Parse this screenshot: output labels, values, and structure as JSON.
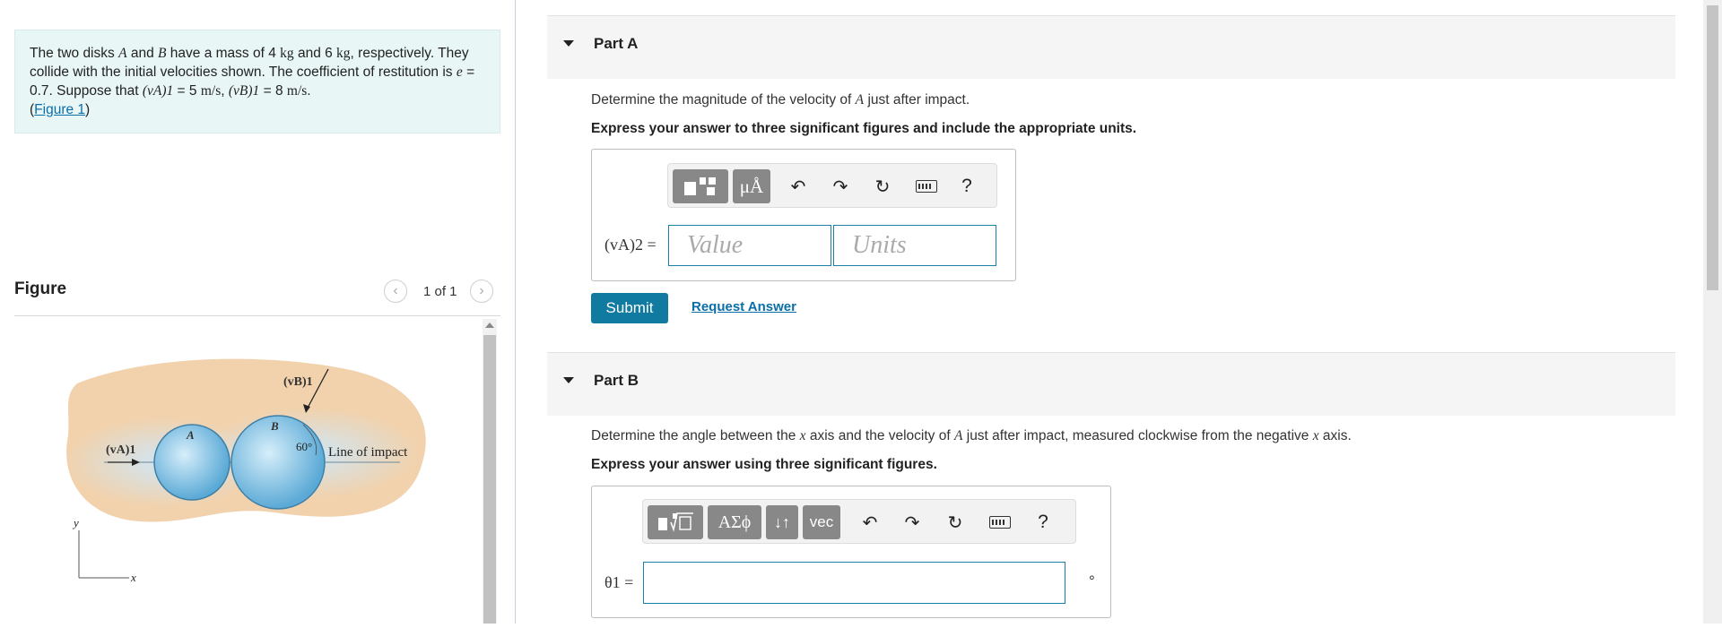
{
  "problem": {
    "t1": "The two disks ",
    "diskA": "A",
    "t2": " and ",
    "diskB": "B",
    "t3": " have a mass of 4 ",
    "unit_kg1": "kg",
    "t4": " and 6 ",
    "unit_kg2": "kg",
    "t5": ", respectively. They collide with the initial velocities shown. The coefficient of restitution is ",
    "e_sym": "e",
    "t6": " = 0.7. Suppose that ",
    "vA1": "(vA)1",
    "t7": " = 5 ",
    "unit_ms1": "m/s",
    "t8": ", ",
    "vB1": "(vB)1",
    "t9": " = 8 ",
    "unit_ms2": "m/s",
    "t10": ".",
    "figure_link": "Figure 1"
  },
  "figure_panel": {
    "title": "Figure",
    "count": "1 of 1",
    "labels": {
      "vb1": "(vB)1",
      "va1": "(vA)1",
      "disk_a": "A",
      "disk_b": "B",
      "angle": "60°",
      "line_of_impact": "Line of impact",
      "axis_y": "y",
      "axis_x": "x"
    }
  },
  "part_a": {
    "title": "Part A",
    "question_pre": "Determine the magnitude of the velocity of ",
    "question_sym": "A",
    "question_post": " just after impact.",
    "instruction": "Express your answer to three significant figures and include the appropriate units.",
    "toolbar": {
      "units_btn": "μÅ",
      "help": "?"
    },
    "answer_label": "(vA)2 =",
    "value_placeholder": "Value",
    "units_placeholder": "Units",
    "submit": "Submit",
    "request": "Request Answer"
  },
  "part_b": {
    "title": "Part B",
    "question_pre": "Determine the angle between the ",
    "x1": "x",
    "question_mid": " axis and the velocity of ",
    "A": "A",
    "question_mid2": " just after impact, measured clockwise from the negative ",
    "x2": "x",
    "question_post": " axis.",
    "instruction": "Express your answer using three significant figures.",
    "toolbar": {
      "greek_btn": "ΑΣϕ",
      "arrows_btn": "↓↑",
      "vec_btn": "vec",
      "help": "?"
    },
    "answer_label": "θ1 =",
    "unit": "°"
  },
  "colors": {
    "accent": "#117aa0",
    "problem_bg": "#e8f6f6",
    "figure_bg": "#f1d2ad",
    "disk": "#6fb7dd"
  }
}
